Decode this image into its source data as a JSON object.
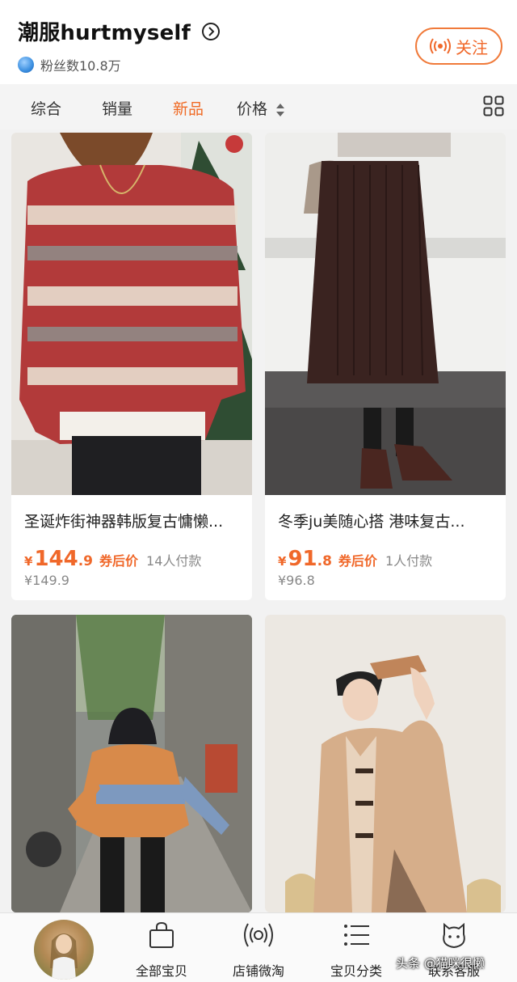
{
  "header": {
    "shop_name": "潮服hurtmyself",
    "fans": "粉丝数10.8万",
    "follow_label": "关注"
  },
  "sort_tabs": [
    "综合",
    "销量",
    "新品",
    "价格"
  ],
  "active_tab": "新品",
  "products": [
    {
      "name": "圣诞炸街神器韩版复古慵懒...",
      "currency": "¥",
      "price_main": "144",
      "price_dec": ".9",
      "coupon": "券后价",
      "paid": "14人付款",
      "orig_price": "¥149.9"
    },
    {
      "name": "冬季ju美随心搭 港味复古...",
      "currency": "¥",
      "price_main": "91",
      "price_dec": ".8",
      "coupon": "券后价",
      "paid": "1人付款",
      "orig_price": "¥96.8"
    }
  ],
  "bottom_nav": [
    {
      "label": "全部宝贝",
      "icon": "shopping-bag-icon"
    },
    {
      "label": "店铺微淘",
      "icon": "broadcast-icon"
    },
    {
      "label": "宝贝分类",
      "icon": "list-icon"
    },
    {
      "label": "联系客服",
      "icon": "chat-face-icon"
    }
  ],
  "watermark": "头条 @猫咪很懒",
  "colors": {
    "accent": "#f0682a",
    "background": "#f2f2f2"
  }
}
